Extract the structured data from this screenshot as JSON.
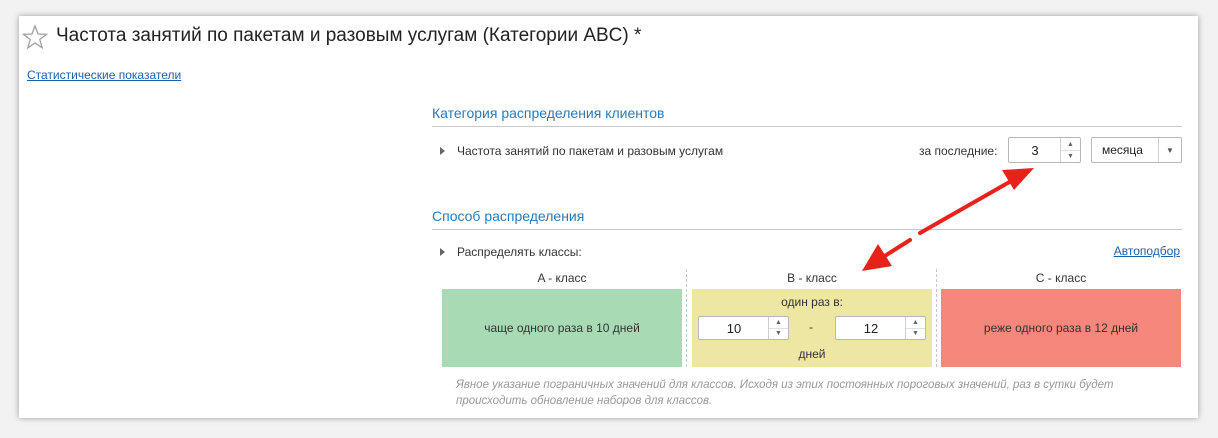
{
  "window": {
    "title": "Частота занятий по пакетам и разовым услугам (Категории ABC) *",
    "stat_link": "Статистические показатели"
  },
  "category_section": {
    "title": "Категория распределения клиентов",
    "row_label": "Частота занятий по пакетам и разовым услугам",
    "period_label": "за последние:",
    "period_value": "3",
    "period_unit": "месяца"
  },
  "method_section": {
    "title": "Способ распределения",
    "row_label": "Распределять классы:",
    "auto_link": "Автоподбор"
  },
  "classes": {
    "a": {
      "header": "A - класс",
      "text": "чаще одного раза в 10 дней",
      "color": "#a8dbb4"
    },
    "b": {
      "header": "B - класс",
      "top_label": "один раз в:",
      "from": "10",
      "dash": "-",
      "to": "12",
      "unit": "дней",
      "color": "#ede7a3"
    },
    "c": {
      "header": "C - класс",
      "text": "реже одного раза в 12 дней",
      "color": "#f6877c"
    }
  },
  "note": "Явное указание пограничных значений для классов. Исходя из этих постоянных пороговых значений, раз в сутки будет происходить обновление наборов для классов.",
  "icons": {
    "favorite": "star-outline-icon",
    "expand": "triangle-right-icon",
    "dropdown": "chevron-down-icon",
    "annotation": "red-double-arrow-icon"
  }
}
